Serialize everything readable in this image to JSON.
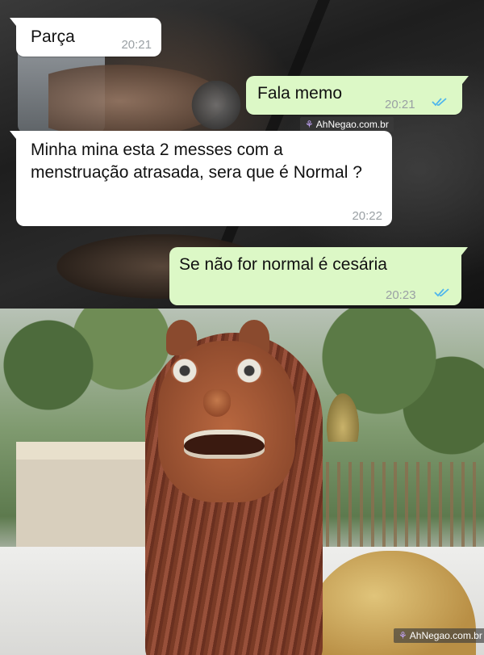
{
  "messages": [
    {
      "direction": "incoming",
      "text": "Parça",
      "time": "20:21"
    },
    {
      "direction": "outgoing",
      "text": "Fala memo",
      "time": "20:21",
      "status": "double-check-icon"
    },
    {
      "direction": "incoming",
      "text": "Minha mina esta 2 messes com a menstruação atrasada, sera que é Normal ?",
      "time": "20:22"
    },
    {
      "direction": "outgoing",
      "text": "Se não for normal é cesária",
      "time": "20:23",
      "status": "double-check-icon"
    }
  ],
  "watermark": {
    "text": "AhNegao.com.br"
  },
  "colors": {
    "incoming_bubble": "#ffffff",
    "outgoing_bubble": "#dcf8c6",
    "time_text": "#9aa0a4",
    "tick_blue": "#4fb6ec"
  }
}
